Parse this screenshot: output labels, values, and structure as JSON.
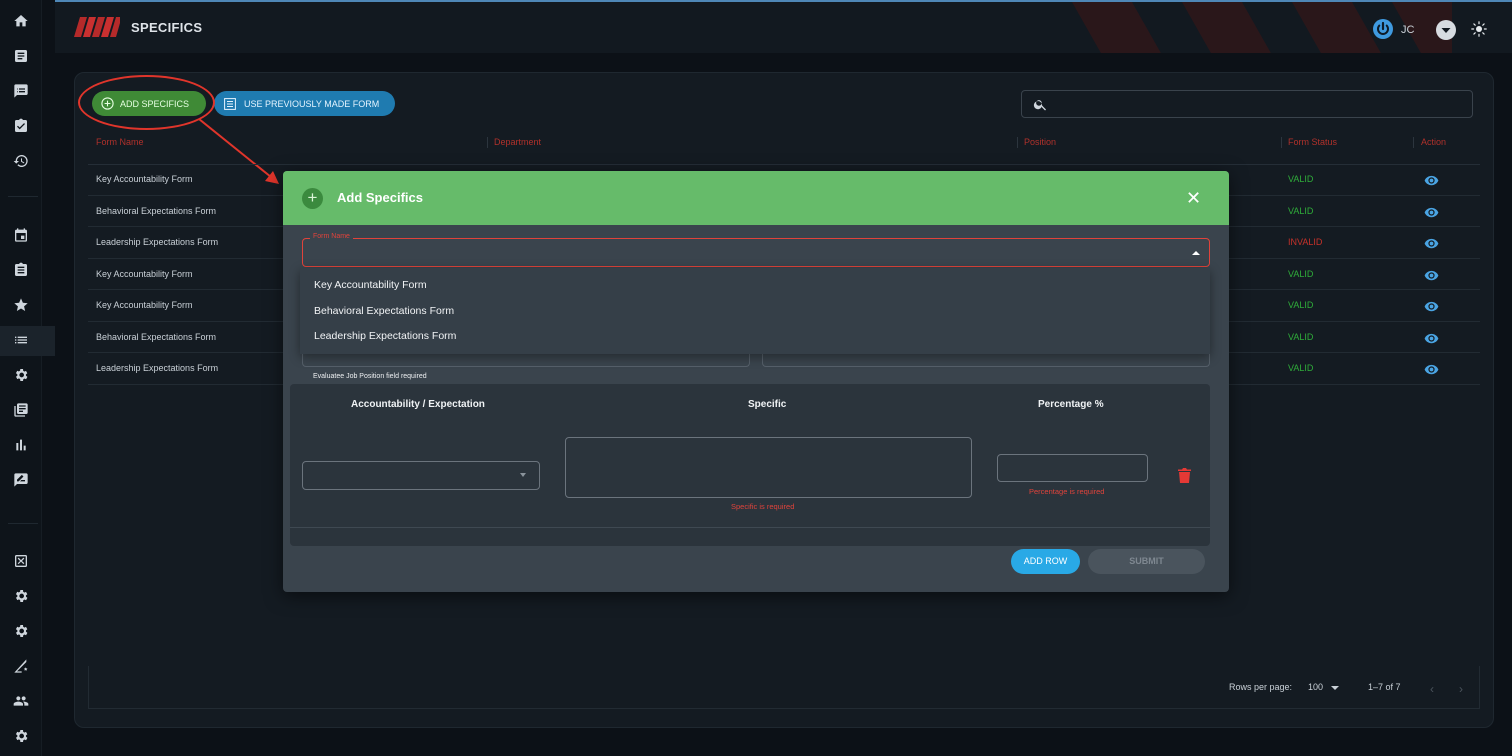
{
  "app": {
    "title": "SPECIFICS",
    "user_initials": "JC"
  },
  "sidebar": {
    "items": [
      {
        "icon": "home-icon"
      },
      {
        "icon": "document-icon"
      },
      {
        "icon": "feedback-icon"
      },
      {
        "icon": "checklist-icon"
      },
      {
        "icon": "history-icon"
      },
      {
        "icon": "calendar-icon"
      },
      {
        "icon": "clipboard-icon"
      },
      {
        "icon": "star-icon"
      },
      {
        "icon": "list-icon"
      },
      {
        "icon": "gear-icon"
      },
      {
        "icon": "library-icon"
      },
      {
        "icon": "bar-chart-icon"
      },
      {
        "icon": "rate-review-icon"
      },
      {
        "icon": "cancel-box-icon"
      },
      {
        "icon": "gear-icon"
      },
      {
        "icon": "gear-icon"
      },
      {
        "icon": "signal-settings-icon"
      },
      {
        "icon": "people-icon"
      },
      {
        "icon": "gear-icon"
      }
    ]
  },
  "toolbar": {
    "add_label": "ADD SPECIFICS",
    "prev_label": "USE PREVIOUSLY MADE FORM",
    "search_placeholder": ""
  },
  "table": {
    "headers": [
      "Form Name",
      "Department",
      "Position",
      "Form Status",
      "Action"
    ],
    "rows": [
      {
        "name": "Key Accountability Form",
        "status": "VALID"
      },
      {
        "name": "Behavioral Expectations Form",
        "status": "VALID"
      },
      {
        "name": "Leadership Expectations Form",
        "status": "INVALID"
      },
      {
        "name": "Key Accountability Form",
        "status": "VALID"
      },
      {
        "name": "Key Accountability Form",
        "status": "VALID"
      },
      {
        "name": "Behavioral Expectations Form",
        "status": "VALID"
      },
      {
        "name": "Leadership Expectations Form",
        "status": "VALID"
      }
    ]
  },
  "pagination": {
    "rows_per_page_label": "Rows per page:",
    "rows_per_page_value": "100",
    "range": "1–7 of 7",
    "prev": "‹",
    "next": "›"
  },
  "modal": {
    "title": "Add Specifics",
    "close": "✕",
    "form_name_label": "Form Name",
    "form_name_options": [
      "Key Accountability Form",
      "Behavioral Expectations Form",
      "Leadership Expectations Form"
    ],
    "evaluatee_helper": "Evaluatee Job Position field required",
    "columns": [
      "Accountability / Expectation",
      "Specific",
      "Percentage %"
    ],
    "specific_error": "Specific is required",
    "percentage_error": "Percentage is required",
    "add_row_label": "ADD ROW",
    "submit_label": "SUBMIT"
  },
  "colors": {
    "accent_green": "#66bb6a",
    "accent_blue": "#29a9e6",
    "valid": "#2fae3a",
    "invalid": "#c7322a",
    "error": "#e0433b"
  }
}
